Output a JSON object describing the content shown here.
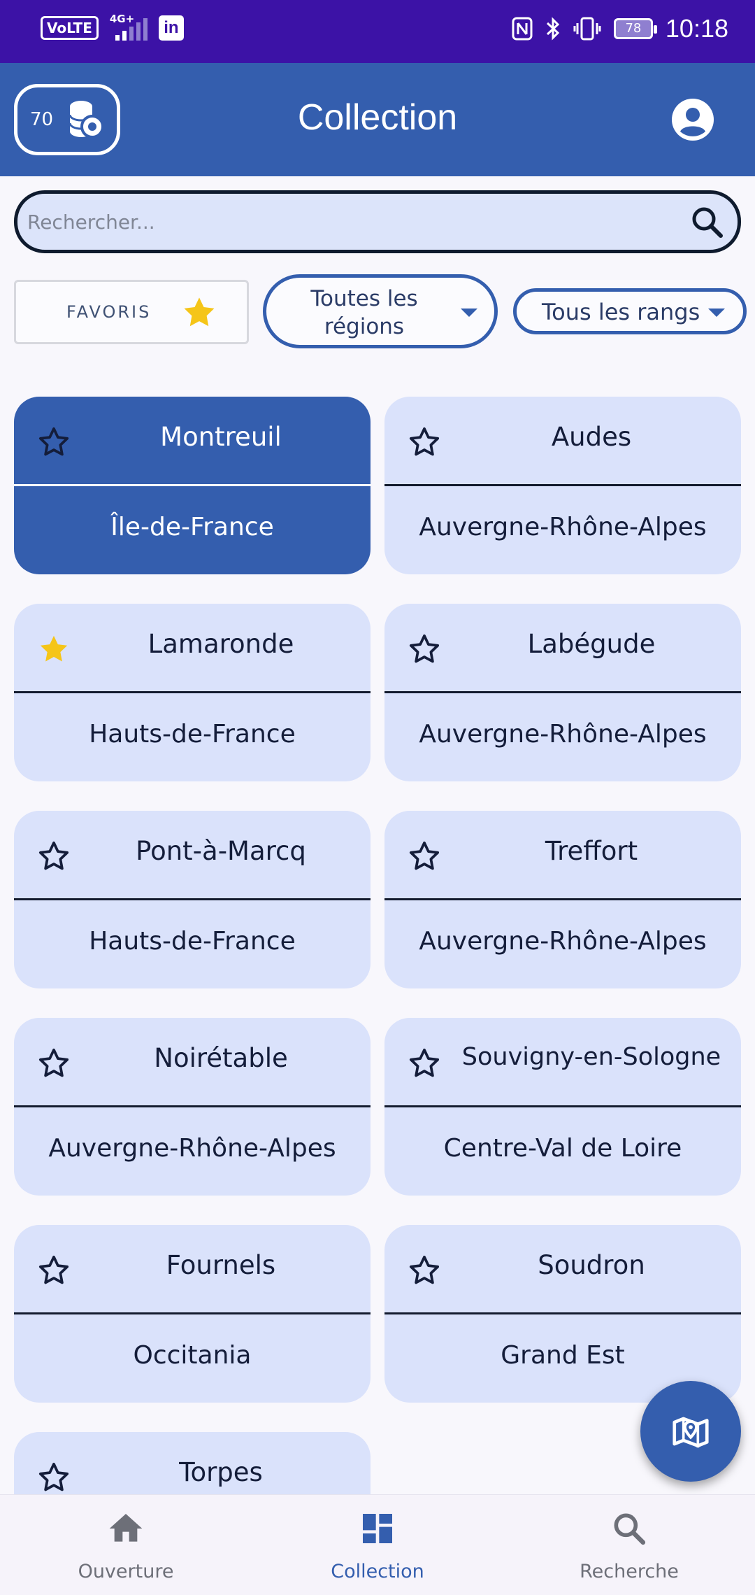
{
  "status_bar": {
    "volte": "VoLTE",
    "network": "4G+",
    "linkedin": "in",
    "battery": "78",
    "time": "10:18"
  },
  "app_bar": {
    "coins": "70",
    "title": "Collection"
  },
  "search": {
    "placeholder": "Rechercher..."
  },
  "filters": {
    "favorites_label": "FAVORIS",
    "region_label": "Toutes les régions",
    "rank_label": "Tous les rangs"
  },
  "colors": {
    "primary": "#345eae",
    "card_bg": "#dae2fb",
    "status_bar": "#3c12a6",
    "favorite_star": "#f5c518"
  },
  "cards": [
    {
      "name": "Montreuil",
      "region": "Île-de-France",
      "favorite": false,
      "selected": true
    },
    {
      "name": "Audes",
      "region": "Auvergne-Rhône-Alpes",
      "favorite": false,
      "selected": false
    },
    {
      "name": "Lamaronde",
      "region": "Hauts-de-France",
      "favorite": true,
      "selected": false
    },
    {
      "name": "Labégude",
      "region": "Auvergne-Rhône-Alpes",
      "favorite": false,
      "selected": false
    },
    {
      "name": "Pont-à-Marcq",
      "region": "Hauts-de-France",
      "favorite": false,
      "selected": false
    },
    {
      "name": "Treffort",
      "region": "Auvergne-Rhône-Alpes",
      "favorite": false,
      "selected": false
    },
    {
      "name": "Noirétable",
      "region": "Auvergne-Rhône-Alpes",
      "favorite": false,
      "selected": false
    },
    {
      "name": "Souvigny-en-Sologne",
      "region": "Centre-Val de Loire",
      "favorite": false,
      "selected": false
    },
    {
      "name": "Fournels",
      "region": "Occitania",
      "favorite": false,
      "selected": false
    },
    {
      "name": "Soudron",
      "region": "Grand Est",
      "favorite": false,
      "selected": false
    },
    {
      "name": "Torpes",
      "region": "",
      "favorite": false,
      "selected": false
    }
  ],
  "bottom_nav": [
    {
      "label": "Ouverture",
      "icon": "home-icon",
      "active": false
    },
    {
      "label": "Collection",
      "icon": "dashboard-icon",
      "active": true
    },
    {
      "label": "Recherche",
      "icon": "search-icon",
      "active": false
    }
  ],
  "fab": {
    "icon": "map-location-icon"
  }
}
